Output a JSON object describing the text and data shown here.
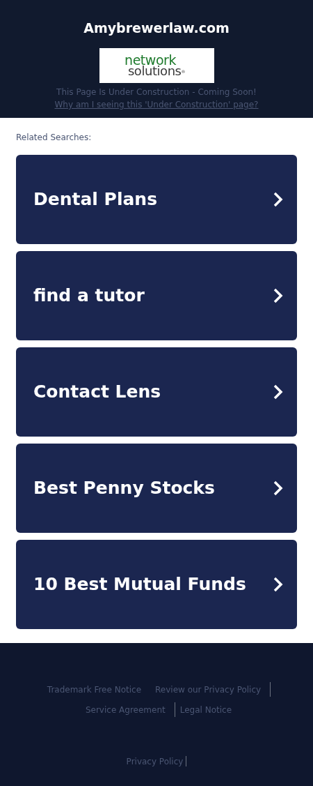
{
  "header": {
    "site_title": "Amybrewerlaw.com",
    "logo": {
      "line_1": "network",
      "line_2": "solutions",
      "mark": "®"
    },
    "notice": "This Page Is Under Construction - Coming Soon!",
    "notice_link": "Why am I seeing this 'Under Construction' page?"
  },
  "related": {
    "heading": "Related Searches:",
    "items": [
      {
        "label": "Dental Plans"
      },
      {
        "label": "find a tutor"
      },
      {
        "label": "Contact Lens"
      },
      {
        "label": "Best Penny Stocks"
      },
      {
        "label": "10 Best Mutual Funds"
      }
    ]
  },
  "footer": {
    "links": [
      {
        "label": "Trademark Free Notice",
        "separator": false
      },
      {
        "label": "Review our Privacy Policy",
        "separator": true
      },
      {
        "label": "Service Agreement",
        "separator": true
      },
      {
        "label": "Legal Notice",
        "separator": false
      }
    ],
    "bottom_link": {
      "label": "Privacy Policy",
      "separator": true
    }
  }
}
